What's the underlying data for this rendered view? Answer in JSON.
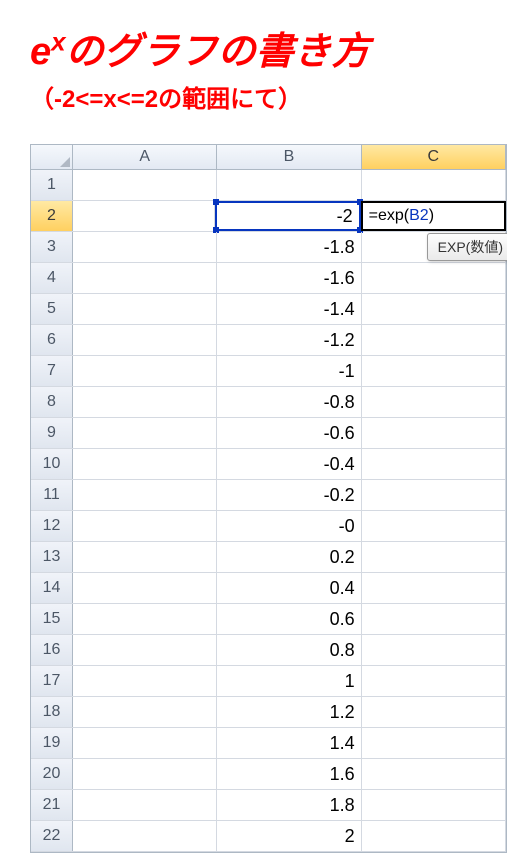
{
  "title": {
    "main_prefix": "e",
    "main_exp": "x",
    "main_suffix": "のグラフの書き方",
    "sub": "（-2<=x<=2の範囲にて）"
  },
  "columns": [
    "A",
    "B",
    "C"
  ],
  "selected_column": "C",
  "selected_row": 2,
  "rows": [
    {
      "num": 1,
      "a": "",
      "b": "",
      "c": ""
    },
    {
      "num": 2,
      "a": "",
      "b": "-2",
      "c": ""
    },
    {
      "num": 3,
      "a": "",
      "b": "-1.8",
      "c": ""
    },
    {
      "num": 4,
      "a": "",
      "b": "-1.6",
      "c": ""
    },
    {
      "num": 5,
      "a": "",
      "b": "-1.4",
      "c": ""
    },
    {
      "num": 6,
      "a": "",
      "b": "-1.2",
      "c": ""
    },
    {
      "num": 7,
      "a": "",
      "b": "-1",
      "c": ""
    },
    {
      "num": 8,
      "a": "",
      "b": "-0.8",
      "c": ""
    },
    {
      "num": 9,
      "a": "",
      "b": "-0.6",
      "c": ""
    },
    {
      "num": 10,
      "a": "",
      "b": "-0.4",
      "c": ""
    },
    {
      "num": 11,
      "a": "",
      "b": "-0.2",
      "c": ""
    },
    {
      "num": 12,
      "a": "",
      "b": "-0",
      "c": ""
    },
    {
      "num": 13,
      "a": "",
      "b": "0.2",
      "c": ""
    },
    {
      "num": 14,
      "a": "",
      "b": "0.4",
      "c": ""
    },
    {
      "num": 15,
      "a": "",
      "b": "0.6",
      "c": ""
    },
    {
      "num": 16,
      "a": "",
      "b": "0.8",
      "c": ""
    },
    {
      "num": 17,
      "a": "",
      "b": "1",
      "c": ""
    },
    {
      "num": 18,
      "a": "",
      "b": "1.2",
      "c": ""
    },
    {
      "num": 19,
      "a": "",
      "b": "1.4",
      "c": ""
    },
    {
      "num": 20,
      "a": "",
      "b": "1.6",
      "c": ""
    },
    {
      "num": 21,
      "a": "",
      "b": "1.8",
      "c": ""
    },
    {
      "num": 22,
      "a": "",
      "b": "2",
      "c": ""
    }
  ],
  "formula": {
    "prefix": "=exp(",
    "ref": "B2",
    "suffix": ")"
  },
  "tooltip": "EXP(数値)"
}
